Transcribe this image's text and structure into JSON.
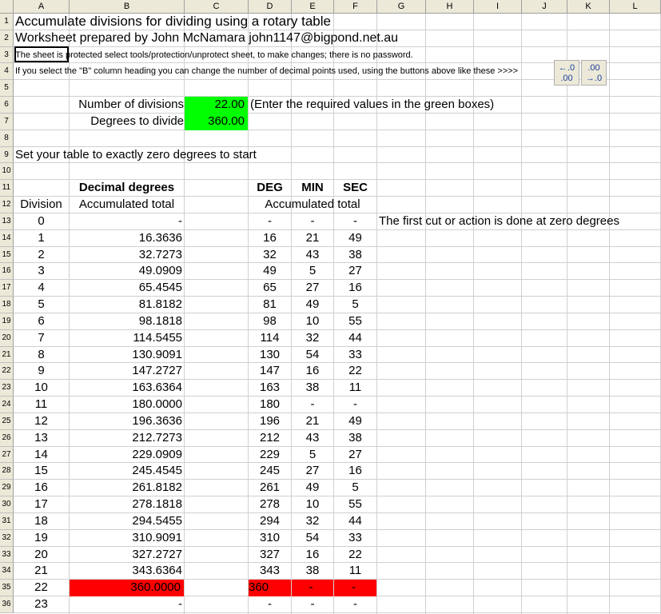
{
  "columns": [
    "A",
    "B",
    "C",
    "D",
    "E",
    "F",
    "G",
    "H",
    "I",
    "J",
    "K",
    "L"
  ],
  "title": "Accumulate divisions for dividing using a rotary table",
  "author": "Worksheet prepared by John McNamara john1147@bigpond.net.au",
  "note_protect": "The sheet is protected select tools/protection/unprotect sheet, to make changes; there is no password.",
  "note_decimal": "If you select the \"B\" column heading you can change the number of decimal points used, using the buttons above like these >>>>",
  "buttons": {
    "increase": "+.0\n.00",
    "decrease": ".00\n→.0"
  },
  "inputs": {
    "divisions_label": "Number of divisions",
    "divisions_value": "22.00",
    "degrees_label": "Degrees to divide",
    "degrees_value": "360.00",
    "hint": "(Enter the required values in the green boxes)"
  },
  "start_note": "Set your table to exactly zero degrees to start",
  "headers": {
    "decimal": "Decimal degrees",
    "deg": "DEG",
    "min": "MIN",
    "sec": "SEC",
    "division": "Division",
    "accum": "Accumulated total",
    "accum2": "Accumulated total"
  },
  "first_cut_note": "The first cut or action is done at  zero degrees",
  "rows": [
    [
      "0",
      "-",
      "-",
      "-",
      "-"
    ],
    [
      "1",
      "16.3636",
      "16",
      "21",
      "49"
    ],
    [
      "2",
      "32.7273",
      "32",
      "43",
      "38"
    ],
    [
      "3",
      "49.0909",
      "49",
      "5",
      "27"
    ],
    [
      "4",
      "65.4545",
      "65",
      "27",
      "16"
    ],
    [
      "5",
      "81.8182",
      "81",
      "49",
      "5"
    ],
    [
      "6",
      "98.1818",
      "98",
      "10",
      "55"
    ],
    [
      "7",
      "114.5455",
      "114",
      "32",
      "44"
    ],
    [
      "8",
      "130.9091",
      "130",
      "54",
      "33"
    ],
    [
      "9",
      "147.2727",
      "147",
      "16",
      "22"
    ],
    [
      "10",
      "163.6364",
      "163",
      "38",
      "11"
    ],
    [
      "11",
      "180.0000",
      "180",
      "-",
      "-"
    ],
    [
      "12",
      "196.3636",
      "196",
      "21",
      "49"
    ],
    [
      "13",
      "212.7273",
      "212",
      "43",
      "38"
    ],
    [
      "14",
      "229.0909",
      "229",
      "5",
      "27"
    ],
    [
      "15",
      "245.4545",
      "245",
      "27",
      "16"
    ],
    [
      "16",
      "261.8182",
      "261",
      "49",
      "5"
    ],
    [
      "17",
      "278.1818",
      "278",
      "10",
      "55"
    ],
    [
      "18",
      "294.5455",
      "294",
      "32",
      "44"
    ],
    [
      "19",
      "310.9091",
      "310",
      "54",
      "33"
    ],
    [
      "20",
      "327.2727",
      "327",
      "16",
      "22"
    ],
    [
      "21",
      "343.6364",
      "343",
      "38",
      "11"
    ],
    [
      "22",
      "360.0000",
      "360",
      "-",
      "-"
    ],
    [
      "23",
      "-",
      "-",
      "-",
      "-"
    ]
  ],
  "highlight_row": "22",
  "colors": {
    "green": "#00ff00",
    "red": "#ff0000"
  }
}
